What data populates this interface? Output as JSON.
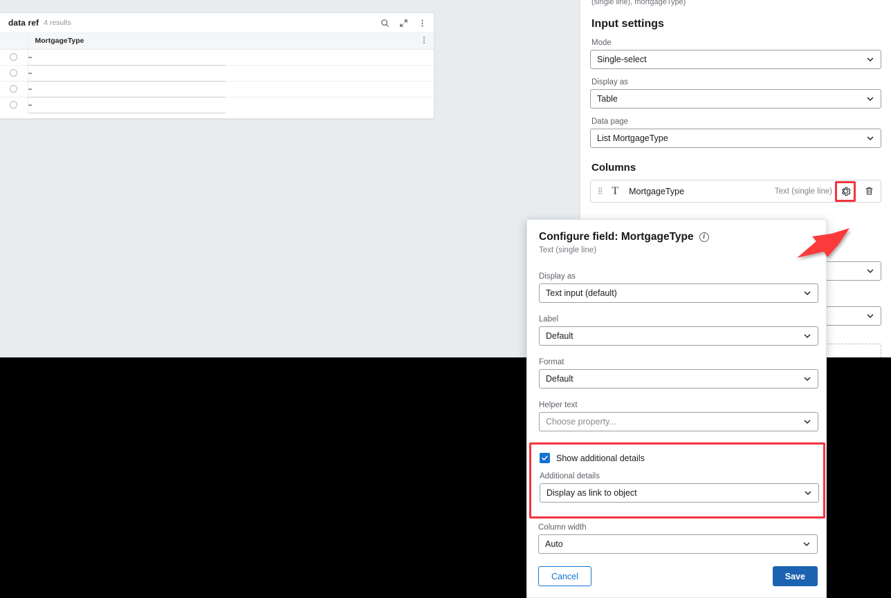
{
  "page": {
    "background_light": "#e8ecef",
    "background_dark": "#000000",
    "accent_blue": "#1472d1",
    "highlight_red": "#f5333f"
  },
  "data_ref_panel": {
    "title": "data ref",
    "result_count": "4 results",
    "toolbar": [
      {
        "name": "search-icon",
        "label": "Search"
      },
      {
        "name": "expand-icon",
        "label": "Expand"
      },
      {
        "name": "more-options-icon",
        "label": "More options"
      }
    ],
    "table": {
      "columns": [
        "MortgageType"
      ],
      "rows": [
        "--",
        "--",
        "--",
        "--"
      ],
      "header_menu_icon": "more-vertical-icon"
    }
  },
  "settings_panel": {
    "clipped_breadcrumb": "(single line), mortgageType)",
    "heading": "Input settings",
    "fields": [
      {
        "label": "Mode",
        "value": "Single-select",
        "name": "mode-select"
      },
      {
        "label": "Display as",
        "value": "Table",
        "name": "display-as-select"
      },
      {
        "label": "Data page",
        "value": "List MortgageType",
        "name": "data-page-select"
      }
    ],
    "columns_heading": "Columns",
    "column_row": {
      "drag_handle": "drag-handle-icon",
      "type_glyph": "T",
      "name": "MortgageType",
      "type_label": "Text (single line)",
      "gear_icon": "gear-icon",
      "delete_icon": "trash-icon",
      "gear_highlighted": true
    }
  },
  "modal": {
    "title": "Configure field: MortgageType",
    "info_icon": "info-icon",
    "subtitle": "Text (single line)",
    "fields": [
      {
        "label": "Display as",
        "value": "Text input (default)",
        "name": "modal-display-as-select",
        "placeholder": false
      },
      {
        "label": "Label",
        "value": "Default",
        "name": "modal-label-select",
        "placeholder": false
      },
      {
        "label": "Format",
        "value": "Default",
        "name": "modal-format-select",
        "placeholder": false
      },
      {
        "label": "Helper text",
        "value": "Choose property...",
        "name": "modal-helper-text-select",
        "placeholder": true
      }
    ],
    "highlighted_section": {
      "checkbox_label": "Show additional details",
      "checkbox_checked": true,
      "field_label": "Additional details",
      "field_value": "Display as link to object"
    },
    "column_width": {
      "label": "Column width",
      "value": "Auto"
    },
    "buttons": {
      "cancel": "Cancel",
      "save": "Save"
    }
  },
  "annotations": {
    "arrow": "red-arrow-pointing-to-gear"
  }
}
